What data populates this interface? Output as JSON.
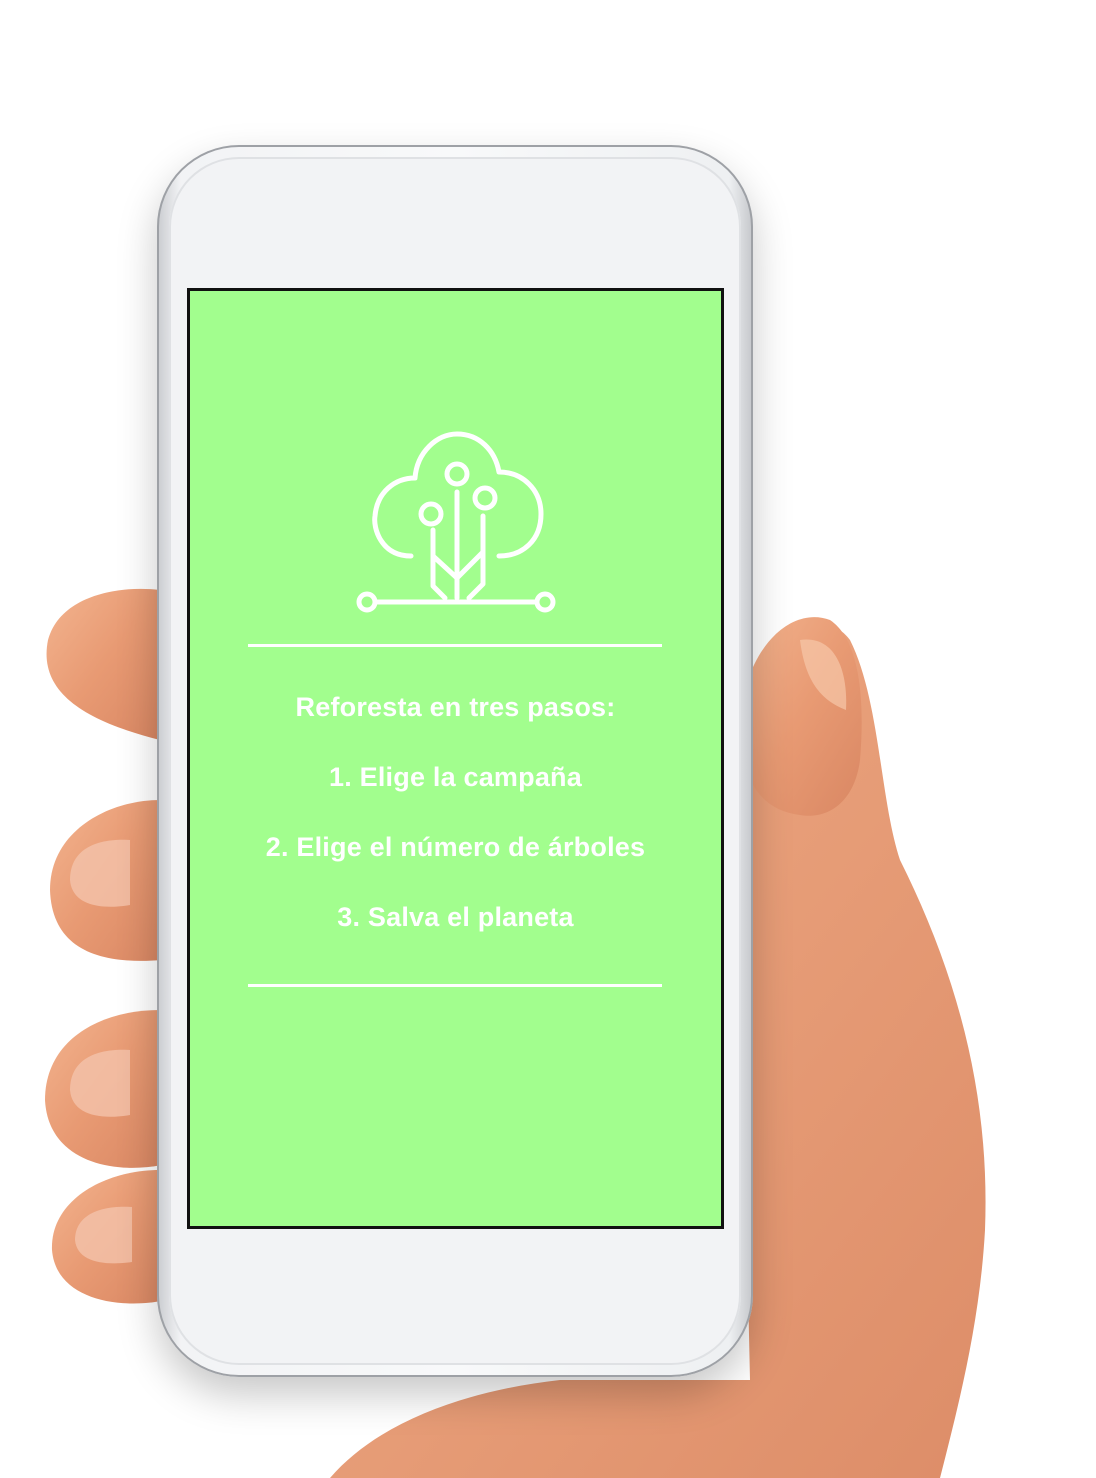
{
  "colors": {
    "screen_background": "#a2fe8e",
    "foreground": "#ffffff",
    "phone_body": "#f4f5f7",
    "skin": "#e9a07c"
  },
  "screen": {
    "logo_icon": "tree-circuit-icon",
    "heading": "Reforesta en tres pasos:",
    "steps": [
      "1. Elige la campaña",
      "2. Elige el número de árboles",
      "3. Salva el planeta"
    ]
  }
}
